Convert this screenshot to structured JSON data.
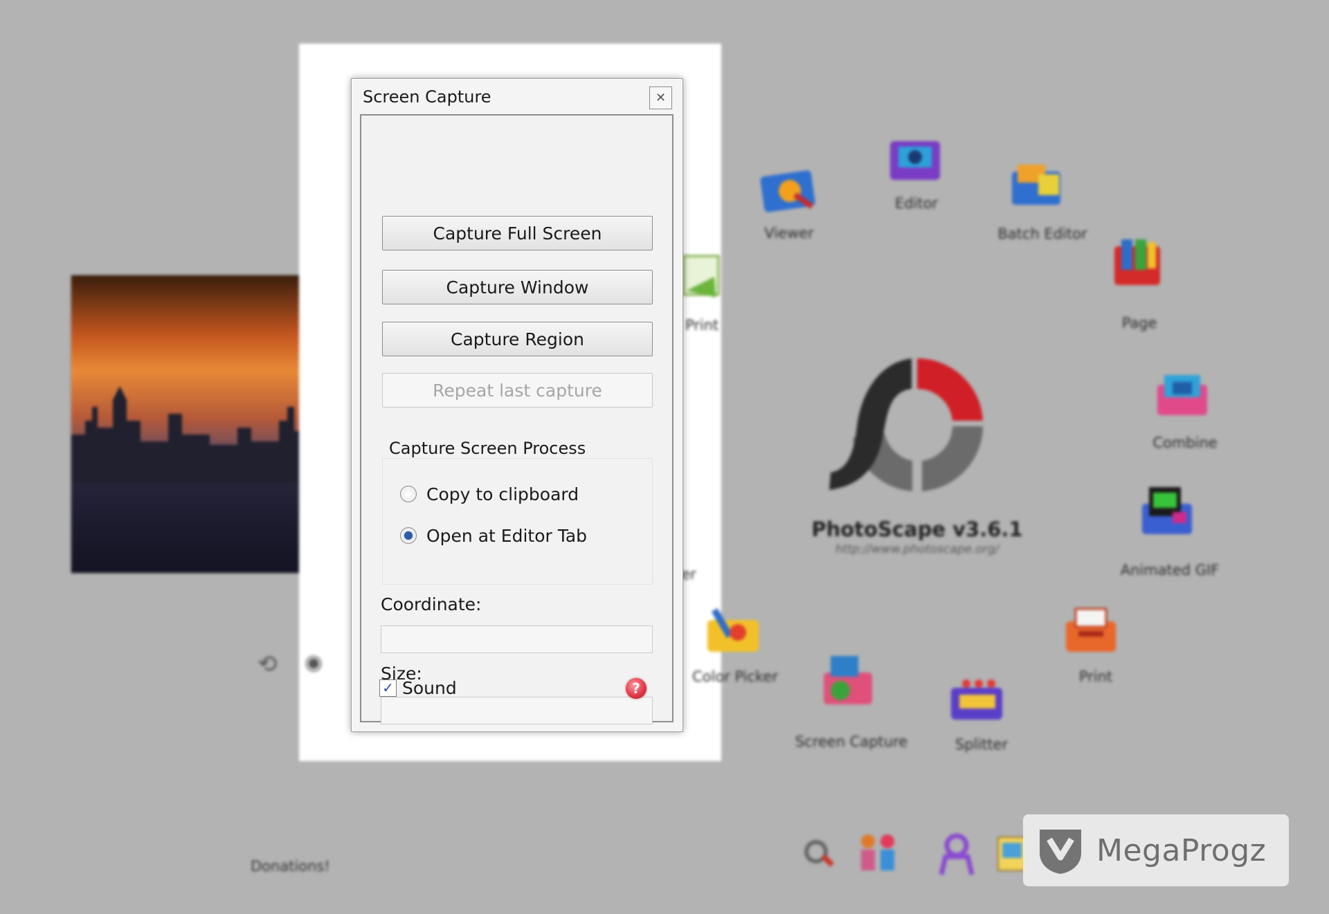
{
  "dialog": {
    "title": "Screen Capture",
    "close_icon": "close-icon",
    "buttons": {
      "capture_full_screen": "Capture Full Screen",
      "capture_window": "Capture Window",
      "capture_region": "Capture Region",
      "repeat_last_capture": "Repeat last capture"
    },
    "process_group": {
      "legend": "Capture Screen Process",
      "options": [
        {
          "label": "Copy to clipboard",
          "selected": false
        },
        {
          "label": "Open at Editor Tab",
          "selected": true
        }
      ]
    },
    "coordinate": {
      "label": "Coordinate:",
      "value": ""
    },
    "size": {
      "label": "Size:",
      "value": ""
    },
    "sound": {
      "label": "Sound",
      "checked": true
    },
    "help_icon": "help-icon"
  },
  "background_app": {
    "product_title": "PhotoScape v3.6.1",
    "product_url": "http://www.photoscape.org/",
    "menu_items": {
      "viewer": "Viewer",
      "editor": "Editor",
      "batch_editor": "Batch Editor",
      "page": "Page",
      "combine": "Combine",
      "animated_gif": "Animated GIF",
      "print": "Print",
      "splitter": "Splitter",
      "screen_capture": "Screen Capture",
      "color_picker": "Color Picker",
      "paper_print_partial": "er Print",
      "converter_partial": "erter"
    },
    "donations": "Donations!"
  },
  "watermark": {
    "text": "MegaProgz",
    "icon": "download-shield-icon"
  },
  "colors": {
    "background": "#b3b3b3",
    "logo_red": "#d01f27",
    "logo_dark": "#2b2b2b",
    "logo_gray": "#6b6b6b",
    "radio_selected": "#2c5aa8"
  }
}
